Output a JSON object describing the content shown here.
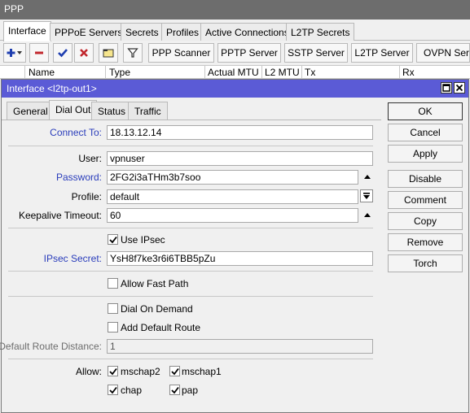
{
  "window": {
    "title": "PPP"
  },
  "tabs": [
    {
      "label": "Interface"
    },
    {
      "label": "PPPoE Servers"
    },
    {
      "label": "Secrets"
    },
    {
      "label": "Profiles"
    },
    {
      "label": "Active Connections"
    },
    {
      "label": "L2TP Secrets"
    }
  ],
  "toolbar": {
    "icons": [
      "plus-icon",
      "minus-icon",
      "check-icon",
      "x-icon",
      "comment-icon",
      "filter-icon"
    ],
    "buttons": [
      {
        "label": "PPP Scanner"
      },
      {
        "label": "PPTP Server"
      },
      {
        "label": "SSTP Server"
      },
      {
        "label": "L2TP Server"
      },
      {
        "label": "OVPN Serve"
      }
    ]
  },
  "list": {
    "columns": [
      "Name",
      "Type",
      "Actual MTU",
      "L2 MTU",
      "Tx",
      "Rx"
    ]
  },
  "dialog": {
    "title": "Interface <l2tp-out1>",
    "tabs": [
      "General",
      "Dial Out",
      "Status",
      "Traffic"
    ],
    "fields": {
      "connect_to": {
        "label": "Connect To:",
        "value": "18.13.12.14"
      },
      "user": {
        "label": "User:",
        "value": "vpnuser"
      },
      "password": {
        "label": "Password:",
        "value": "2FG2i3aTHm3b7soo"
      },
      "profile": {
        "label": "Profile:",
        "value": "default"
      },
      "keepalive": {
        "label": "Keepalive Timeout:",
        "value": "60"
      },
      "use_ipsec": {
        "label": "Use IPsec",
        "checked": true
      },
      "ipsec_secret": {
        "label": "IPsec Secret:",
        "value": "YsH8f7ke3r6i6TBB5pZu"
      },
      "allow_fast_path": {
        "label": "Allow Fast Path",
        "checked": false
      },
      "dial_on_demand": {
        "label": "Dial On Demand",
        "checked": false
      },
      "add_default_route": {
        "label": "Add Default Route",
        "checked": false
      },
      "default_route_distance": {
        "label": "Default Route Distance:",
        "value": "1"
      },
      "allow": {
        "label": "Allow:",
        "options": [
          {
            "label": "mschap2",
            "checked": true
          },
          {
            "label": "mschap1",
            "checked": true
          },
          {
            "label": "chap",
            "checked": true
          },
          {
            "label": "pap",
            "checked": true
          }
        ]
      }
    },
    "buttons": [
      {
        "label": "OK"
      },
      {
        "label": "Cancel"
      },
      {
        "label": "Apply"
      },
      {
        "label": "Disable"
      },
      {
        "label": "Comment"
      },
      {
        "label": "Copy"
      },
      {
        "label": "Remove"
      },
      {
        "label": "Torch"
      }
    ]
  }
}
